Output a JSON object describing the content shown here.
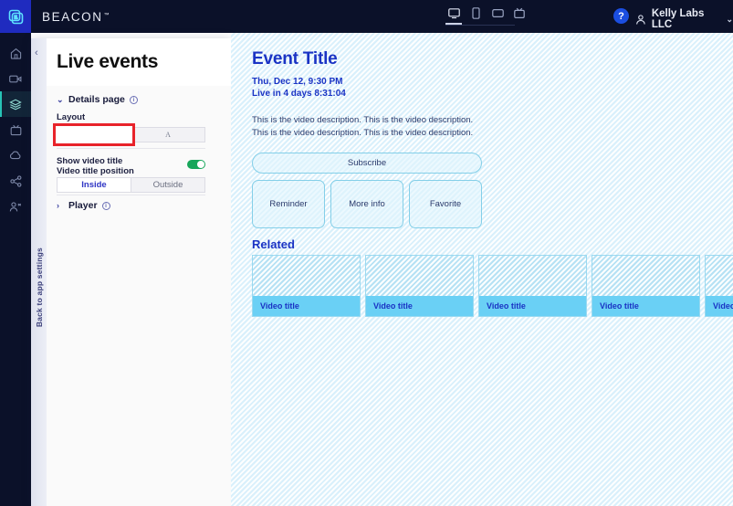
{
  "topbar": {
    "brand": "BEACON",
    "brand_tm": "™",
    "logo_icon": "beacon-logo-icon",
    "devices": [
      {
        "name": "desktop",
        "icon": "desktop-icon",
        "active": true
      },
      {
        "name": "mobile",
        "icon": "mobile-icon",
        "active": false
      },
      {
        "name": "tablet",
        "icon": "tablet-icon",
        "active": false
      },
      {
        "name": "tv",
        "icon": "tv-icon",
        "active": false
      }
    ],
    "help_label": "?",
    "account_name": "Kelly Labs LLC",
    "account_chevron": "⌄",
    "account_icon": "person-icon"
  },
  "rail": {
    "items": [
      {
        "name": "home",
        "icon": "home-icon",
        "active": false
      },
      {
        "name": "video",
        "icon": "video-camera-icon",
        "active": false
      },
      {
        "name": "live-events",
        "icon": "layers-icon",
        "active": true
      },
      {
        "name": "tv-apps",
        "icon": "tv-icon",
        "active": false
      },
      {
        "name": "cloud",
        "icon": "cloud-icon",
        "active": false
      },
      {
        "name": "share",
        "icon": "share-icon",
        "active": false
      },
      {
        "name": "audience",
        "icon": "people-icon",
        "active": false
      }
    ]
  },
  "panel": {
    "back_link": "Back to app settings",
    "collapse_chevron": "‹",
    "title": "Live events",
    "details": {
      "chevron": "⌄",
      "heading": "Details page",
      "info_icon": "info-icon",
      "layout_label": "Layout",
      "layout_options": [
        {
          "name": "layout-single-column",
          "icon": "vertical-bar-icon",
          "selected": true
        },
        {
          "name": "layout-two-column",
          "icon": "letter-a-icon",
          "selected": false
        }
      ],
      "show_title_label": "Show video title",
      "position_label": "Video title position",
      "toggle_on": true,
      "position_options": [
        {
          "label": "Inside",
          "selected": true
        },
        {
          "label": "Outside",
          "selected": false
        }
      ]
    },
    "player": {
      "chevron": "›",
      "heading": "Player",
      "info_icon": "info-icon"
    }
  },
  "preview": {
    "event_title": "Event Title",
    "event_date": "Thu, Dec 12, 9:30 PM",
    "countdown": "Live in 4 days 8:31:04",
    "description": "This is the video description. This is the video description. This is the video description. This is the video description.",
    "subscribe_label": "Subscribe",
    "actions": [
      "Reminder",
      "More info",
      "Favorite"
    ],
    "related_heading": "Related",
    "related_cards": [
      {
        "title": "Video title"
      },
      {
        "title": "Video title"
      },
      {
        "title": "Video title"
      },
      {
        "title": "Video title"
      },
      {
        "title": "Video title"
      }
    ]
  },
  "colors": {
    "topbar_bg": "#0b1129",
    "logo_tile": "#1f2bbf",
    "rail_active": "#27c3b6",
    "accent_blue": "#1a33c4",
    "toggle_green": "#17a65a",
    "focus_red": "#e8232a",
    "card_blue": "#6ad0f5",
    "preview_bg": "#e8f6fd"
  }
}
